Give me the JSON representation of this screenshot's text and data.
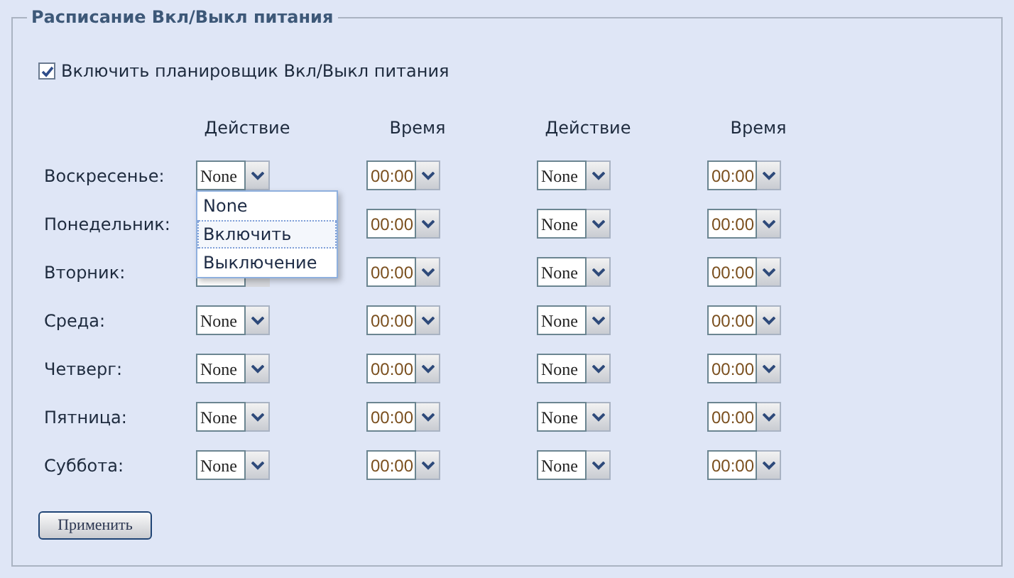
{
  "panel": {
    "title": "Расписание Вкл/Выкл питания"
  },
  "enable": {
    "label": "Включить планировщик Вкл/Выкл питания",
    "checked": true
  },
  "columns": [
    "Действие",
    "Время",
    "Действие",
    "Время"
  ],
  "days": [
    {
      "label": "Воскресенье:",
      "cells": [
        {
          "kind": "action",
          "value": "None",
          "open": true
        },
        {
          "kind": "time",
          "value": "00:00"
        },
        {
          "kind": "action",
          "value": "None"
        },
        {
          "kind": "time",
          "value": "00:00"
        }
      ]
    },
    {
      "label": "Понедельник:",
      "cells": [
        null,
        {
          "kind": "time",
          "value": "00:00"
        },
        {
          "kind": "action",
          "value": "None"
        },
        {
          "kind": "time",
          "value": "00:00"
        }
      ]
    },
    {
      "label": "Вторник:",
      "cells": [
        {
          "kind": "covered"
        },
        {
          "kind": "time",
          "value": "00:00"
        },
        {
          "kind": "action",
          "value": "None"
        },
        {
          "kind": "time",
          "value": "00:00"
        }
      ]
    },
    {
      "label": "Среда:",
      "cells": [
        {
          "kind": "action",
          "value": "None"
        },
        {
          "kind": "time",
          "value": "00:00"
        },
        {
          "kind": "action",
          "value": "None"
        },
        {
          "kind": "time",
          "value": "00:00"
        }
      ]
    },
    {
      "label": "Четверг:",
      "cells": [
        {
          "kind": "action",
          "value": "None"
        },
        {
          "kind": "time",
          "value": "00:00"
        },
        {
          "kind": "action",
          "value": "None"
        },
        {
          "kind": "time",
          "value": "00:00"
        }
      ]
    },
    {
      "label": "Пятница:",
      "cells": [
        {
          "kind": "action",
          "value": "None"
        },
        {
          "kind": "time",
          "value": "00:00"
        },
        {
          "kind": "action",
          "value": "None"
        },
        {
          "kind": "time",
          "value": "00:00"
        }
      ]
    },
    {
      "label": "Суббота:",
      "cells": [
        {
          "kind": "action",
          "value": "None"
        },
        {
          "kind": "time",
          "value": "00:00"
        },
        {
          "kind": "action",
          "value": "None"
        },
        {
          "kind": "time",
          "value": "00:00"
        }
      ]
    }
  ],
  "menu": {
    "options": [
      {
        "label": "None",
        "selected": false
      },
      {
        "label": "Включить",
        "selected": true
      },
      {
        "label": "Выключение",
        "selected": false
      }
    ]
  },
  "apply_button": "Применить"
}
